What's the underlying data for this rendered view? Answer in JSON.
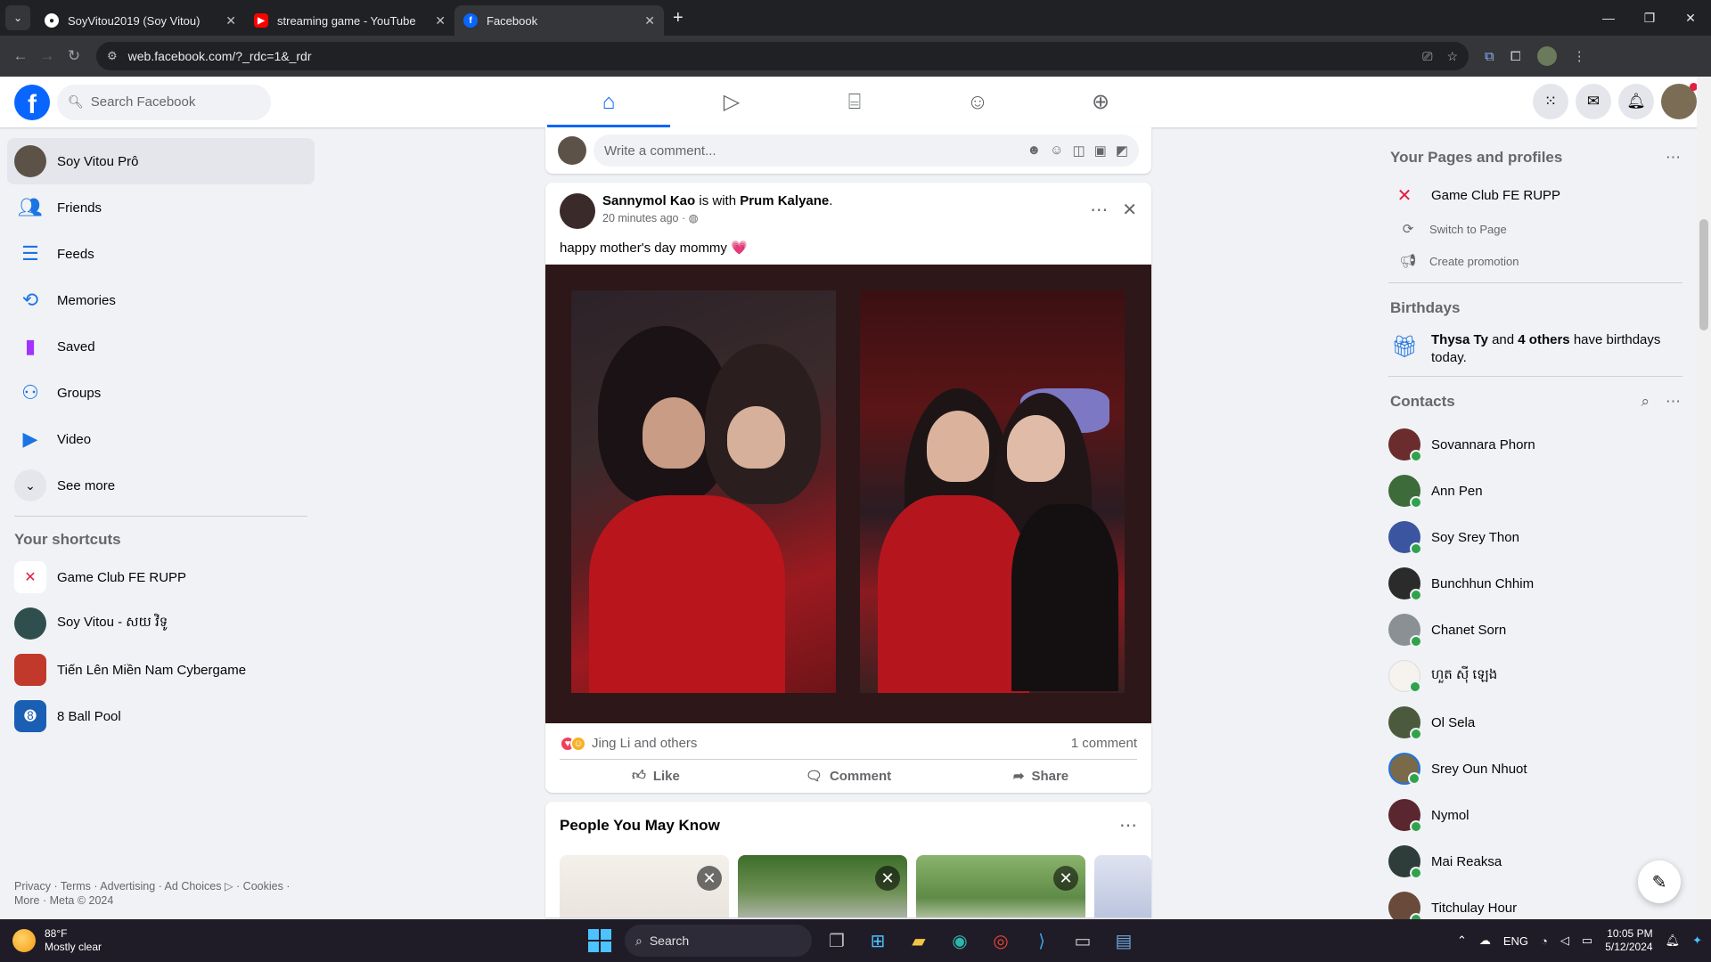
{
  "browser": {
    "tabs": [
      {
        "title": "SoyVitou2019 (Soy Vitou)",
        "icon": "github-icon",
        "active": false
      },
      {
        "title": "streaming game - YouTube",
        "icon": "youtube-icon",
        "active": false
      },
      {
        "title": "Facebook",
        "icon": "facebook-icon",
        "active": true
      }
    ],
    "url": "web.facebook.com/?_rdc=1&_rdr"
  },
  "header": {
    "search_placeholder": "Search Facebook"
  },
  "left_nav": {
    "items": [
      {
        "label": "Soy Vitou Prô",
        "icon": "profile-avatar"
      },
      {
        "label": "Friends",
        "icon": "friends-icon"
      },
      {
        "label": "Feeds",
        "icon": "feeds-icon"
      },
      {
        "label": "Memories",
        "icon": "memories-icon"
      },
      {
        "label": "Saved",
        "icon": "saved-icon"
      },
      {
        "label": "Groups",
        "icon": "groups-icon"
      },
      {
        "label": "Video",
        "icon": "video-icon"
      },
      {
        "label": "See more",
        "icon": "chevron-down-icon"
      }
    ],
    "shortcuts_title": "Your shortcuts",
    "shortcuts": [
      {
        "label": "Game Club FE RUPP"
      },
      {
        "label": "Soy Vitou - សយ វិទូ"
      },
      {
        "label": "Tiến Lên Miền Nam Cybergame"
      },
      {
        "label": "8 Ball Pool"
      }
    ],
    "footer_line1": "Privacy · Terms · Advertising · Ad Choices ▷ · Cookies ·",
    "footer_line2": "More · Meta © 2024"
  },
  "feed": {
    "comment_placeholder": "Write a comment...",
    "post": {
      "author": "Sannymol Kao",
      "with_text": "is with",
      "tagged": "Prum Kalyane",
      "time": "20 minutes ago",
      "text": "happy mother's day mommy 💗",
      "reactions_text": "Jing Li and others",
      "comments_count": "1 comment",
      "like_label": "Like",
      "comment_label": "Comment",
      "share_label": "Share"
    },
    "pymk_title": "People You May Know"
  },
  "right": {
    "pages_title": "Your Pages and profiles",
    "page_name": "Game Club FE RUPP",
    "switch_label": "Switch to Page",
    "promo_label": "Create promotion",
    "birthdays_title": "Birthdays",
    "birthday_name": "Thysa Ty",
    "birthday_mid": "and",
    "birthday_others": "4 others",
    "birthday_tail": "have birthdays today.",
    "contacts_title": "Contacts",
    "contacts": [
      "Sovannara Phorn",
      "Ann Pen",
      "Soy Srey Thon",
      "Bunchhun Chhim",
      "Chanet Sorn",
      "ហួត ស៊ី ឡេង",
      "Ol Sela",
      "Srey Oun Nhuot",
      "Nymol",
      "Mai Reaksa",
      "Titchulay Hour"
    ]
  },
  "taskbar": {
    "temp": "88°F",
    "weather": "Mostly clear",
    "search_label": "Search",
    "lang": "ENG",
    "time": "10:05 PM",
    "date": "5/12/2024"
  },
  "colors": {
    "brand": "#0866ff",
    "page_bg": "#f0f2f5",
    "online": "#31a24c"
  }
}
